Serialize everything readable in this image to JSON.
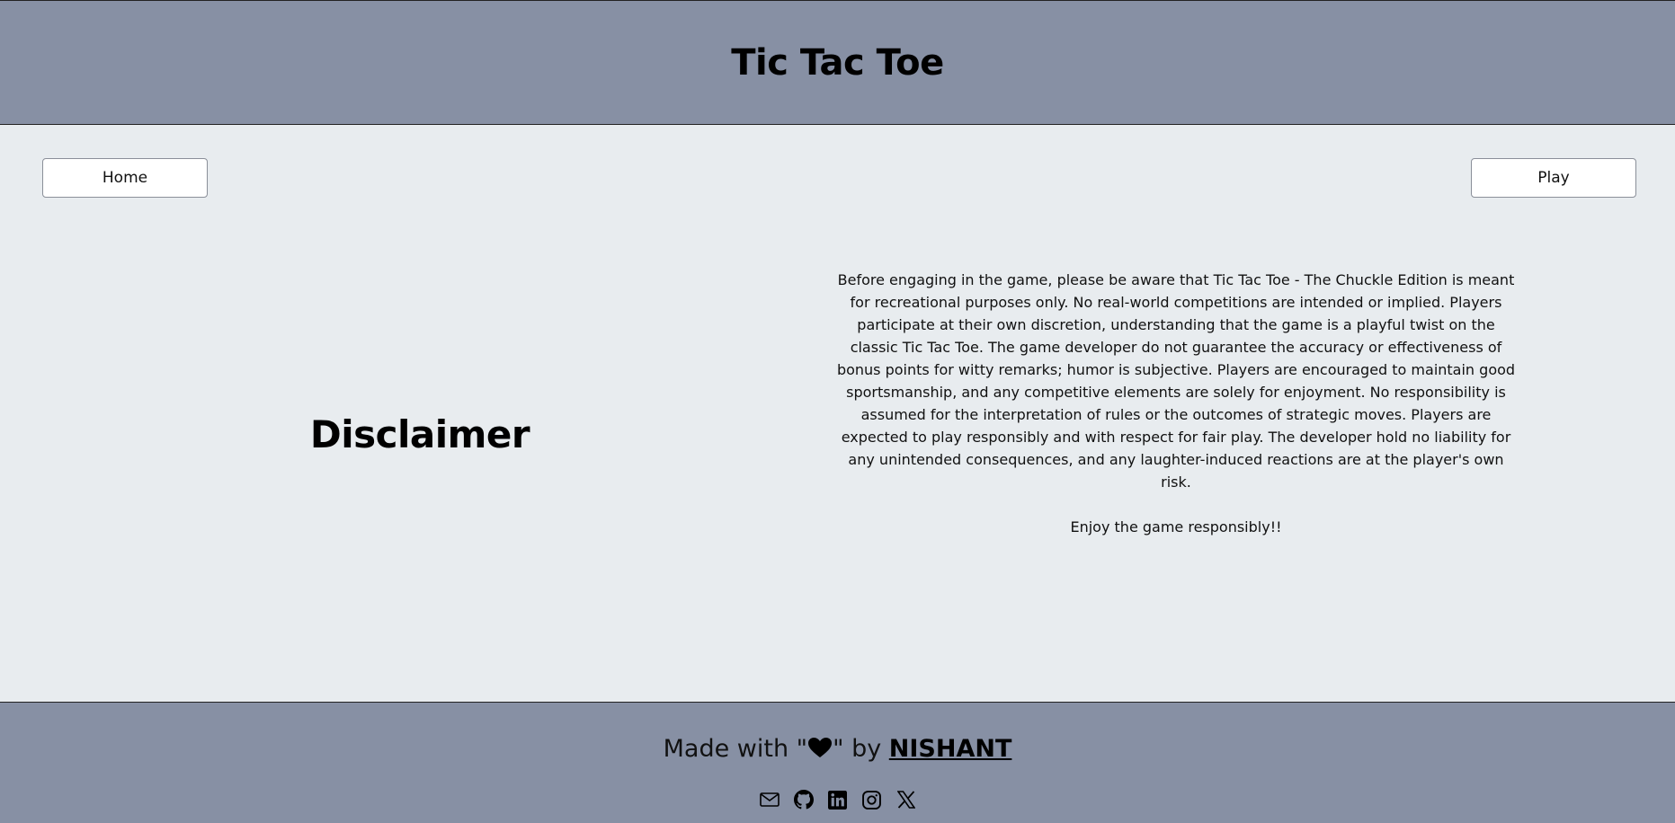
{
  "header": {
    "title": "Tic Tac Toe"
  },
  "nav": {
    "home_label": "Home",
    "play_label": "Play"
  },
  "disclaimer": {
    "title": "Disclaimer",
    "body": "Before engaging in the game, please be aware that Tic Tac Toe - The Chuckle Edition is meant for recreational purposes only. No real-world competitions are intended or implied. Players participate at their own discretion, understanding that the game is a playful twist on the classic Tic Tac Toe. The game developer do not guarantee the accuracy or effectiveness of bonus points for witty remarks; humor is subjective. Players are encouraged to maintain good sportsmanship, and any competitive elements are solely for enjoyment. No responsibility is assumed for the interpretation of rules or the outcomes of strategic moves. Players are expected to play responsibly and with respect for fair play. The developer hold no liability for any unintended consequences, and any laughter-induced reactions are at the player's own risk.",
    "closing": "Enjoy the game responsibly!!"
  },
  "footer": {
    "made_with_prefix": "Made with \"",
    "made_with_suffix": "\" by ",
    "author": "NISHANT",
    "heart_icon": "heart-icon",
    "socials": [
      "email-icon",
      "github-icon",
      "linkedin-icon",
      "instagram-icon",
      "x-icon"
    ]
  },
  "colors": {
    "header_bg": "#8790a4",
    "page_bg": "#e8ecef",
    "button_bg": "#ffffff"
  }
}
